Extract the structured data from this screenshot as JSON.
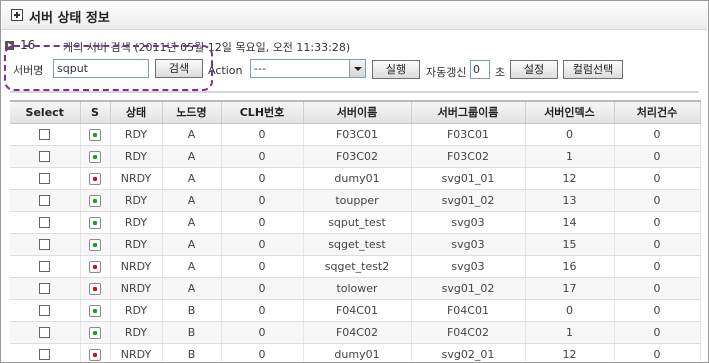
{
  "window": {
    "title": "서버 상태 정보"
  },
  "summary": {
    "count": "16",
    "description": "개의 서버 검색 (2011년 05월 12일 목요일, 오전 11:33:28)"
  },
  "search": {
    "label": "서버명",
    "value": "sqput",
    "button": "검색"
  },
  "action": {
    "label": "Action",
    "selected": "---",
    "run_button": "실행"
  },
  "refresh": {
    "label": "자동갱신",
    "value": "0",
    "unit": "초",
    "settings_button": "설정",
    "columns_button": "컬럼선택"
  },
  "table": {
    "headers": [
      "Select",
      "S",
      "상태",
      "노드명",
      "CLH번호",
      "서버이름",
      "서버그룹이름",
      "서버인덱스",
      "처리건수"
    ],
    "rows": [
      {
        "status_color": "green",
        "state": "RDY",
        "node": "A",
        "clh": "0",
        "server": "F03C01",
        "group": "F03C01",
        "index": "0",
        "count": "0"
      },
      {
        "status_color": "green",
        "state": "RDY",
        "node": "A",
        "clh": "0",
        "server": "F03C02",
        "group": "F03C02",
        "index": "1",
        "count": "0"
      },
      {
        "status_color": "red",
        "state": "NRDY",
        "node": "A",
        "clh": "0",
        "server": "dumy01",
        "group": "svg01_01",
        "index": "12",
        "count": "0"
      },
      {
        "status_color": "green",
        "state": "RDY",
        "node": "A",
        "clh": "0",
        "server": "toupper",
        "group": "svg01_02",
        "index": "13",
        "count": "0"
      },
      {
        "status_color": "green",
        "state": "RDY",
        "node": "A",
        "clh": "0",
        "server": "sqput_test",
        "group": "svg03",
        "index": "14",
        "count": "0"
      },
      {
        "status_color": "green",
        "state": "RDY",
        "node": "A",
        "clh": "0",
        "server": "sqget_test",
        "group": "svg03",
        "index": "15",
        "count": "0"
      },
      {
        "status_color": "red",
        "state": "NRDY",
        "node": "A",
        "clh": "0",
        "server": "sqget_test2",
        "group": "svg03",
        "index": "16",
        "count": "0"
      },
      {
        "status_color": "red",
        "state": "NRDY",
        "node": "A",
        "clh": "0",
        "server": "tolower",
        "group": "svg01_02",
        "index": "17",
        "count": "0"
      },
      {
        "status_color": "green",
        "state": "RDY",
        "node": "B",
        "clh": "0",
        "server": "F04C01",
        "group": "F04C01",
        "index": "0",
        "count": "0"
      },
      {
        "status_color": "green",
        "state": "RDY",
        "node": "B",
        "clh": "0",
        "server": "F04C02",
        "group": "F04C02",
        "index": "1",
        "count": "0"
      },
      {
        "status_color": "red",
        "state": "NRDY",
        "node": "B",
        "clh": "0",
        "server": "dumy01",
        "group": "svg02_01",
        "index": "12",
        "count": "0"
      }
    ]
  }
}
